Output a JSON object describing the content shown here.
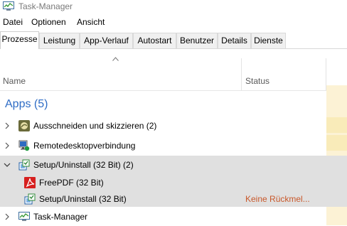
{
  "window": {
    "title": "Task-Manager"
  },
  "menu": [
    "Datei",
    "Optionen",
    "Ansicht"
  ],
  "tabs": [
    "Prozesse",
    "Leistung",
    "App-Verlauf",
    "Autostart",
    "Benutzer",
    "Details",
    "Dienste"
  ],
  "active_tab": "Prozesse",
  "columns": {
    "name": "Name",
    "status": "Status"
  },
  "group": {
    "title": "Apps (5)"
  },
  "rows": [
    {
      "label": "Ausschneiden und skizzieren (2)",
      "icon": "snip-sketch-icon",
      "expanded": false,
      "selected": false,
      "status": ""
    },
    {
      "label": "Remotedesktopverbindung",
      "icon": "remote-desktop-icon",
      "expanded": false,
      "selected": false,
      "status": ""
    },
    {
      "label": "Setup/Uninstall (32 Bit) (2)",
      "icon": "setup-icon",
      "expanded": true,
      "selected": true,
      "status": ""
    },
    {
      "label": "FreePDF (32 Bit)",
      "icon": "freepdf-icon",
      "expanded": null,
      "selected": true,
      "status": ""
    },
    {
      "label": "Setup/Uninstall (32 Bit)",
      "icon": "setup-icon",
      "expanded": null,
      "selected": true,
      "status": "Keine Rückmel..."
    },
    {
      "label": "Task-Manager",
      "icon": "task-manager-icon",
      "expanded": false,
      "selected": false,
      "status": ""
    }
  ],
  "colors": {
    "group_title": "#2e6cc5",
    "status_warning": "#c8582b",
    "selection": "#e0e0e0",
    "cpu_column": "#fcf2d5"
  }
}
